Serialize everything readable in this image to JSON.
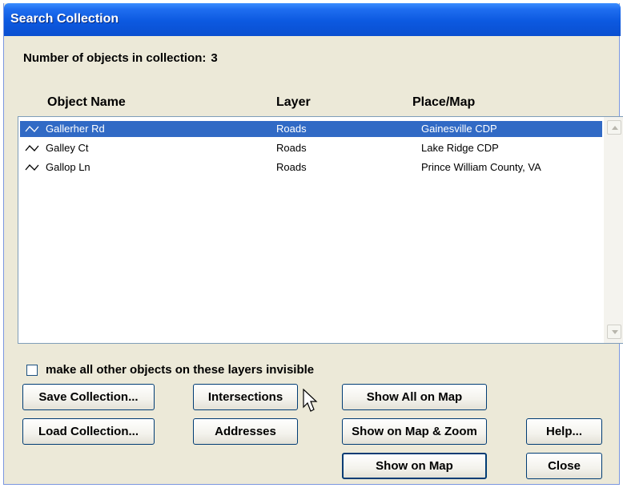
{
  "window": {
    "title": "Search Collection"
  },
  "summary": {
    "label": "Number of objects in collection:",
    "count": "3"
  },
  "columns": {
    "name": "Object Name",
    "layer": "Layer",
    "place": "Place/Map"
  },
  "rows": [
    {
      "icon": "road-line-icon",
      "name": "Gallerher Rd",
      "layer": "Roads",
      "place": "Gainesville CDP",
      "selected": true
    },
    {
      "icon": "road-line-icon",
      "name": "Galley Ct",
      "layer": "Roads",
      "place": "Lake Ridge CDP",
      "selected": false
    },
    {
      "icon": "road-line-icon",
      "name": "Gallop Ln",
      "layer": "Roads",
      "place": "Prince William County, VA",
      "selected": false
    }
  ],
  "options": {
    "invisible_label": "make all other objects on these layers invisible",
    "invisible_checked": false
  },
  "buttons": {
    "save": "Save Collection...",
    "load": "Load Collection...",
    "intersections": "Intersections",
    "addresses": "Addresses",
    "show_all": "Show All on Map",
    "show_zoom": "Show on Map & Zoom",
    "show": "Show on Map",
    "help": "Help...",
    "close": "Close"
  },
  "colors": {
    "titlebar": "#0a4fd0",
    "selection": "#316ac5",
    "dialog_bg": "#ece9d8"
  }
}
